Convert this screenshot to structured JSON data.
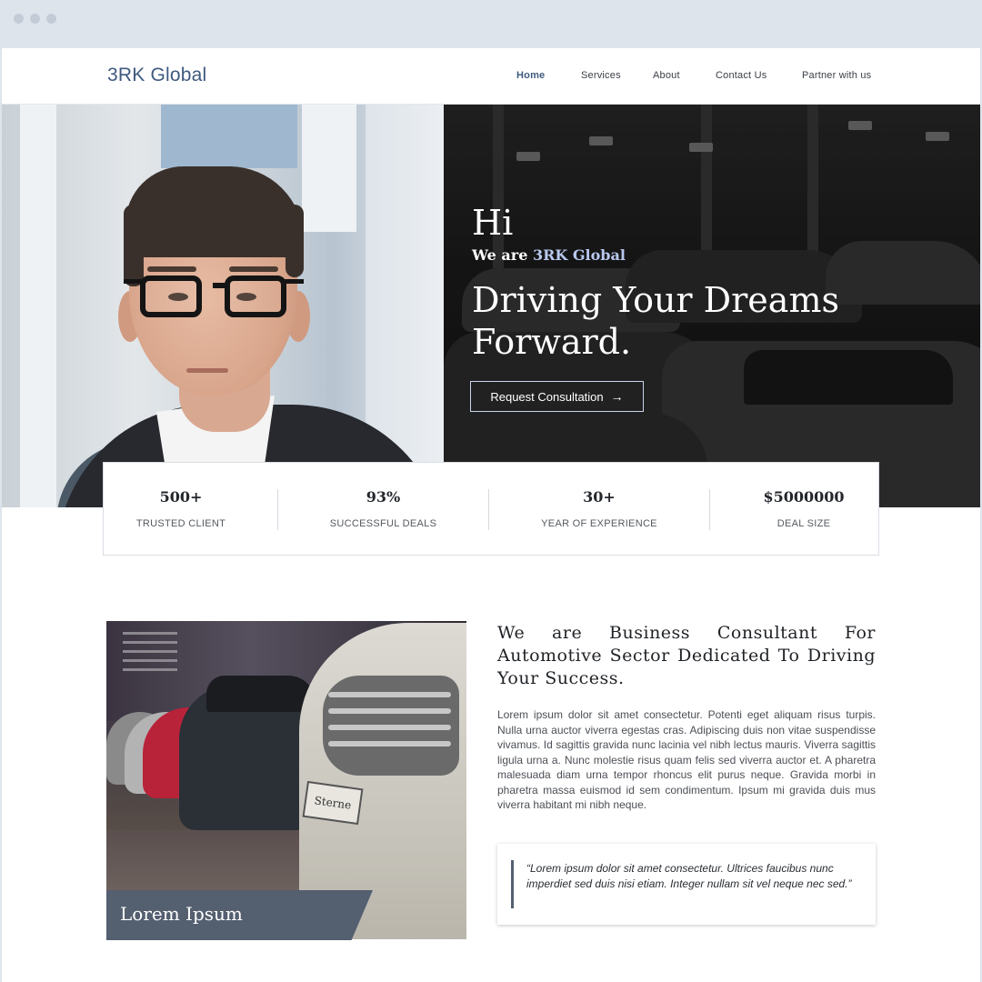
{
  "nav": {
    "brand": "3RK Global",
    "items": [
      {
        "label": "Home",
        "active": true
      },
      {
        "label": "Services",
        "active": false
      },
      {
        "label": "About",
        "active": false
      },
      {
        "label": "Contact Us",
        "active": false
      },
      {
        "label": "Partner with us",
        "active": false
      }
    ]
  },
  "hero": {
    "greeting": "Hi",
    "intro_prefix": "We are ",
    "intro_brand": "3RK Global",
    "headline": "Driving Your Dreams Forward.",
    "cta_label": "Request Consultation",
    "cta_icon": "arrow-right-icon"
  },
  "stats": [
    {
      "value": "500+",
      "label": "TRUSTED CLIENT"
    },
    {
      "value": "93%",
      "label": "SUCCESSFUL DEALS"
    },
    {
      "value": "30+",
      "label": "YEAR OF EXPERIENCE"
    },
    {
      "value": "$5000000",
      "label": "DEAL SIZE"
    }
  ],
  "about": {
    "photo_caption": "Lorem Ipsum",
    "photo_plate": "Sterne",
    "heading": "We are Business Consultant For Automotive Sector Dedicated To Driving Your Success.",
    "body": "Lorem ipsum dolor sit amet consectetur. Potenti eget aliquam risus turpis. Nulla urna auctor viverra egestas cras. Adipiscing duis non vitae suspendisse vivamus. Id sagittis gravida nunc lacinia vel nibh lectus mauris. Viverra sagittis ligula urna a. Nunc molestie risus quam felis sed viverra auctor et. A pharetra malesuada diam urna tempor rhoncus elit purus neque. Gravida morbi in pharetra massa euismod id sem condimentum. Ipsum mi gravida duis mus viverra habitant mi nibh neque.",
    "quote": "“Lorem ipsum dolor sit amet consectetur. Ultrices faucibus nunc imperdiet sed duis nisi etiam. Integer nullam sit vel neque nec sed.”"
  },
  "colors": {
    "accent": "#3f5a7f",
    "caption_bg": "#545f70",
    "hero_highlight": "#b9c8ef"
  }
}
